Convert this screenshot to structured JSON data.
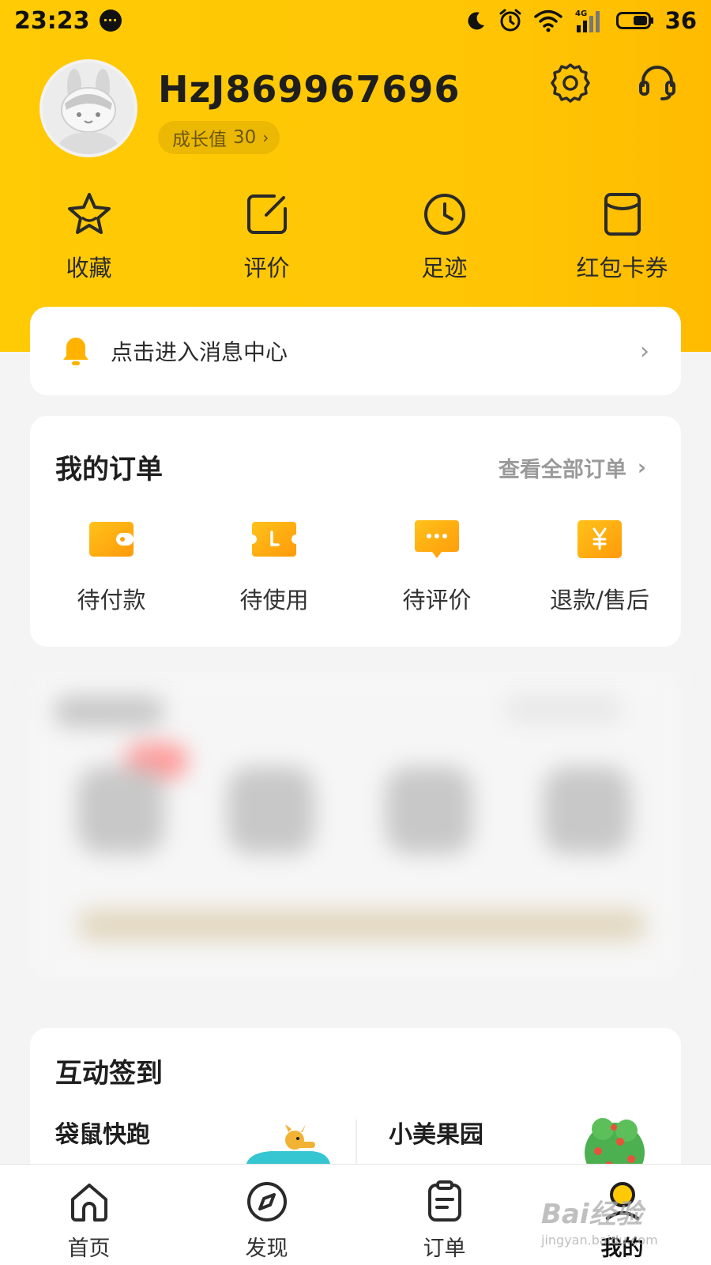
{
  "status_bar": {
    "time": "23:23",
    "network": "4G",
    "battery": "36"
  },
  "profile": {
    "username": "HzJ869967696",
    "growth_label": "成长值",
    "growth_value": "30",
    "growth_chevron": "›"
  },
  "quick_actions": [
    {
      "label": "收藏",
      "icon": "star-icon"
    },
    {
      "label": "评价",
      "icon": "edit-icon"
    },
    {
      "label": "足迹",
      "icon": "clock-icon"
    },
    {
      "label": "红包卡券",
      "icon": "coupon-icon"
    }
  ],
  "message_center": {
    "text": "点击进入消息中心",
    "chevron": "›"
  },
  "orders": {
    "title": "我的订单",
    "view_all": "查看全部订单",
    "chevron": "›",
    "items": [
      {
        "label": "待付款",
        "icon": "wallet-icon"
      },
      {
        "label": "待使用",
        "icon": "ticket-icon"
      },
      {
        "label": "待评价",
        "icon": "comment-icon"
      },
      {
        "label": "退款/售后",
        "icon": "refund-icon"
      }
    ]
  },
  "signin": {
    "title": "互动签到",
    "games": [
      "袋鼠快跑",
      "小美果园"
    ]
  },
  "tab_bar": {
    "items": [
      {
        "label": "首页",
        "icon": "home-icon"
      },
      {
        "label": "发现",
        "icon": "compass-icon"
      },
      {
        "label": "订单",
        "icon": "clipboard-icon"
      },
      {
        "label": "我的",
        "icon": "profile-icon",
        "active": true
      }
    ]
  },
  "watermark": {
    "main": "Bai经验",
    "sub": "jingyan.baidu.com"
  },
  "colors": {
    "brand_yellow": "#ffc905",
    "order_icon_orange": "#ffa10a"
  }
}
